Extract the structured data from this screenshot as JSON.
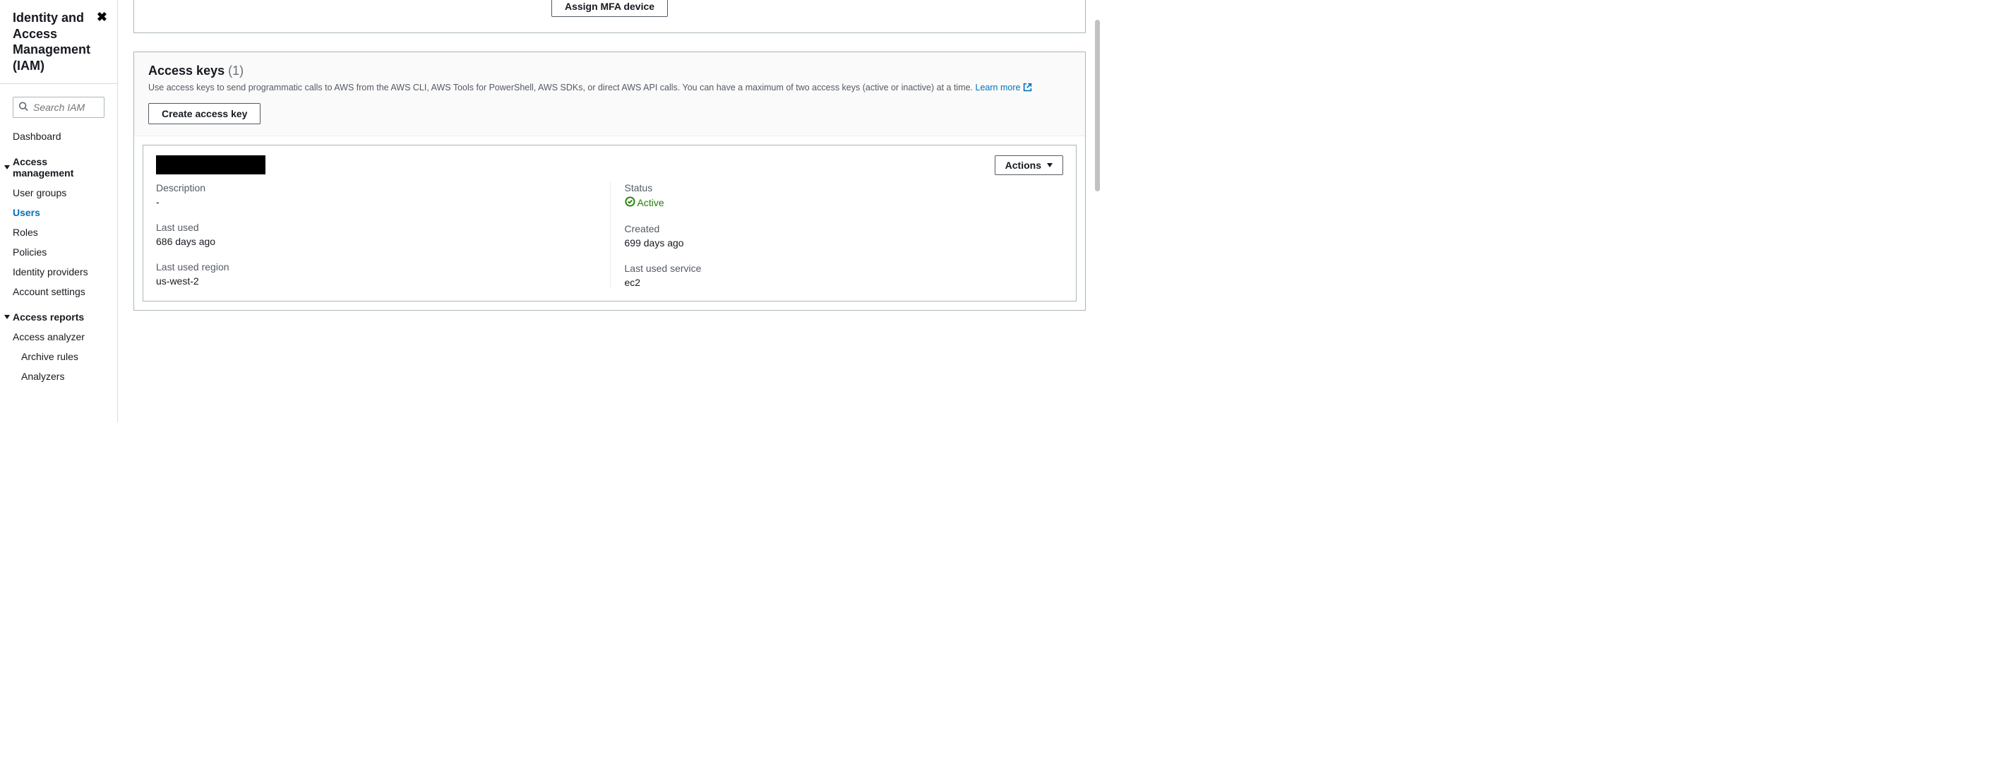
{
  "sidebar": {
    "title": "Identity and Access Management (IAM)",
    "search_placeholder": "Search IAM",
    "items": {
      "dashboard": "Dashboard",
      "access_management": "Access management",
      "user_groups": "User groups",
      "users": "Users",
      "roles": "Roles",
      "policies": "Policies",
      "identity_providers": "Identity providers",
      "account_settings": "Account settings",
      "access_reports": "Access reports",
      "access_analyzer": "Access analyzer",
      "archive_rules": "Archive rules",
      "analyzers": "Analyzers"
    }
  },
  "mfa": {
    "button": "Assign MFA device"
  },
  "access_keys": {
    "title": "Access keys",
    "count": "(1)",
    "description": "Use access keys to send programmatic calls to AWS from the AWS CLI, AWS Tools for PowerShell, AWS SDKs, or direct AWS API calls. You can have a maximum of two access keys (active or inactive) at a time.",
    "learn_more": "Learn more",
    "create_button": "Create access key",
    "actions_button": "Actions",
    "fields": {
      "description_label": "Description",
      "description_value": "-",
      "status_label": "Status",
      "status_value": "Active",
      "last_used_label": "Last used",
      "last_used_value": "686 days ago",
      "created_label": "Created",
      "created_value": "699 days ago",
      "last_used_region_label": "Last used region",
      "last_used_region_value": "us-west-2",
      "last_used_service_label": "Last used service",
      "last_used_service_value": "ec2"
    }
  }
}
